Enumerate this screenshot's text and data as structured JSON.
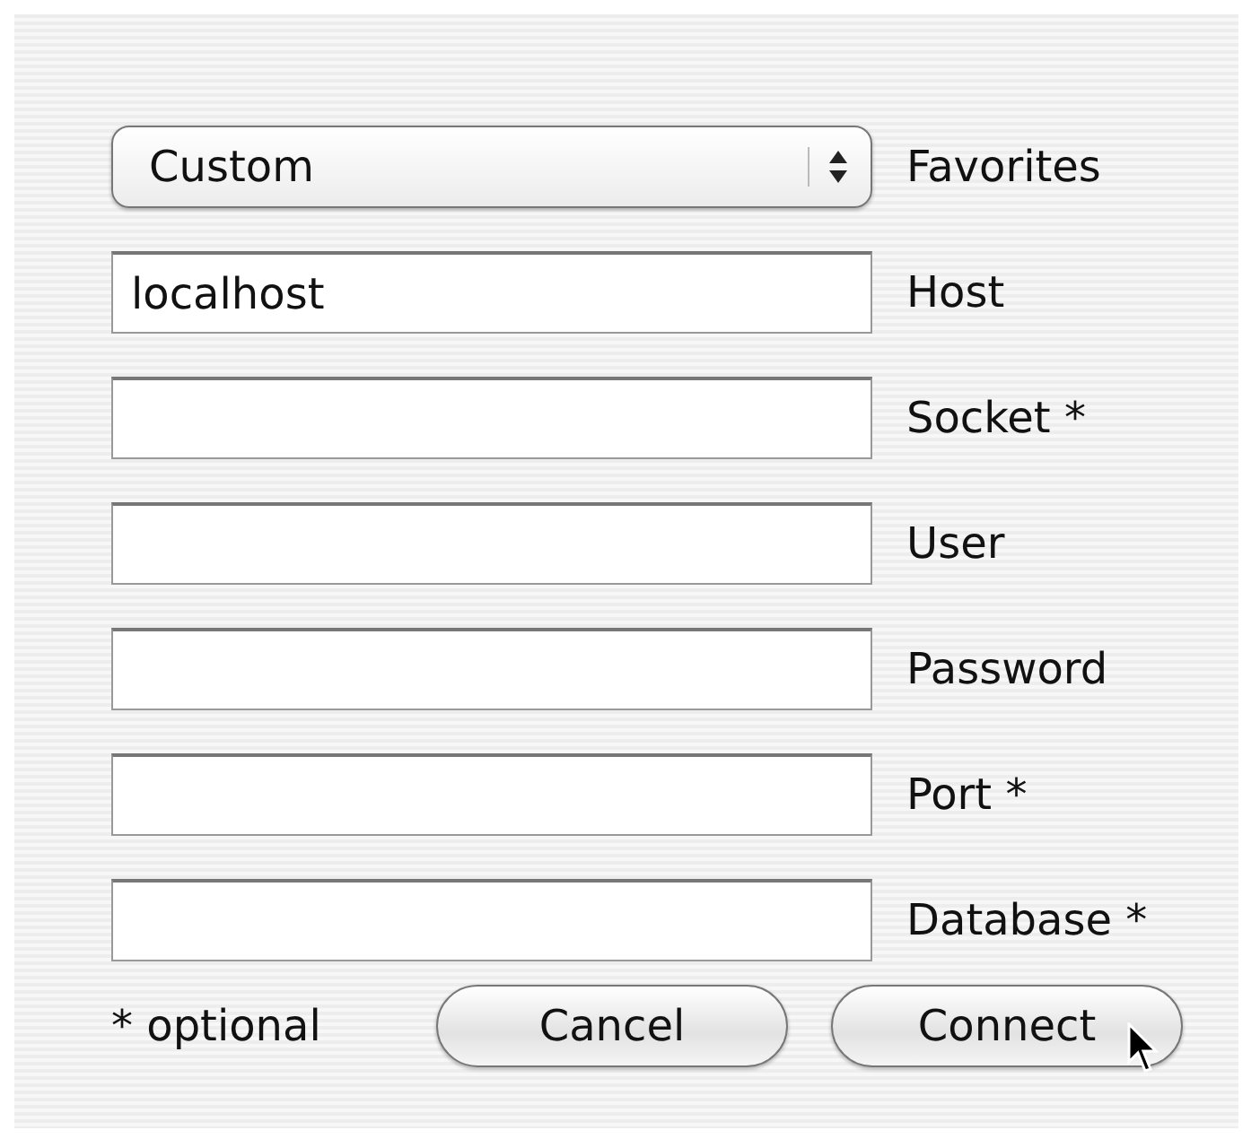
{
  "favorites": {
    "value": "Custom",
    "label": "Favorites"
  },
  "fields": [
    {
      "label": "Host",
      "value": "localhost"
    },
    {
      "label": "Socket *"
    },
    {
      "label": "User"
    },
    {
      "label": "Password"
    },
    {
      "label": "Port *"
    },
    {
      "label": "Database *"
    }
  ],
  "note": "* optional",
  "buttons": [
    "Cancel",
    "Connect"
  ]
}
